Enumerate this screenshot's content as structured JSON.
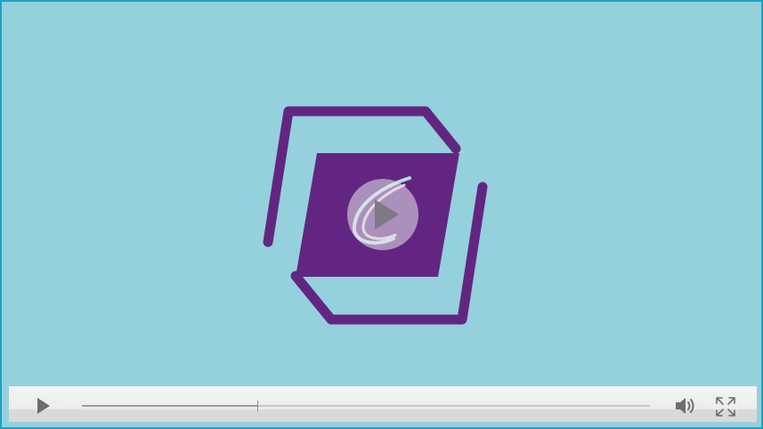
{
  "player": {
    "colors": {
      "background": "#94d1dc",
      "frame": "#17a3c2",
      "logo_purple": "#622682",
      "controlbar": "#ececec",
      "control_icons": "#6e6e6e"
    },
    "poster": {
      "logo": "hexagon-box-logo"
    },
    "big_play_button": {
      "icon": "play-icon"
    },
    "controls": {
      "play_icon": "play-icon",
      "volume_icon": "volume-icon",
      "fullscreen_icon": "fullscreen-icon",
      "progress_fraction": 0.31
    }
  }
}
